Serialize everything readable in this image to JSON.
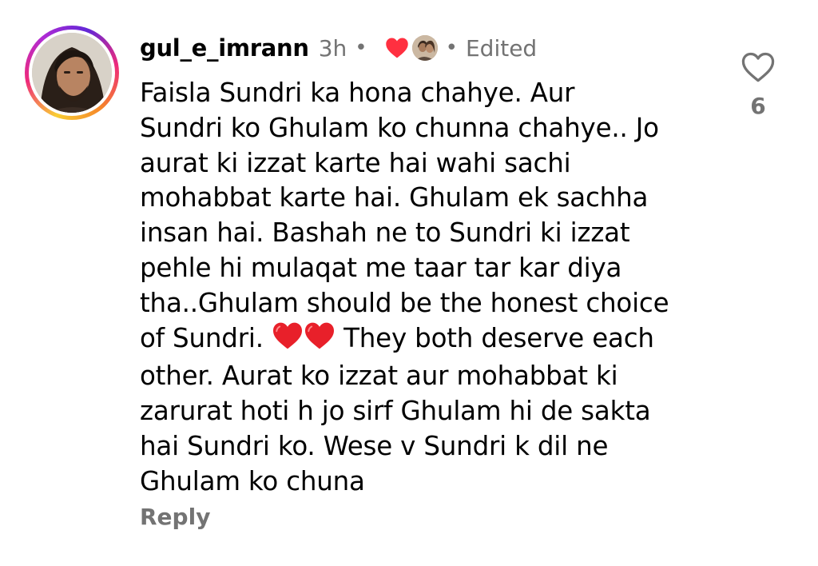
{
  "comment": {
    "username": "gul_e_imrann",
    "time": "3h",
    "separator": "•",
    "edited": "Edited",
    "lines": [
      "Faisla Sundri ka hona chahye. Aur",
      "Sundri ko Ghulam ko chunna chahye.. Jo",
      "aurat ki izzat karte hai wahi sachi",
      "mohabbat karte hai. Ghulam ek sachha",
      "insan hai. Bashah ne to Sundri ki izzat",
      "pehle hi mulaqat me taar tar kar diya",
      "tha..Ghulam should be the honest choice"
    ],
    "line8_before": "of Sundri.",
    "line8_after": "They both deserve each",
    "lines_after": [
      "other. Aurat ko izzat aur mohabbat ki",
      "zarurat hoti h jo sirf Ghulam hi de sakta",
      "hai Sundri ko. Wese v Sundri k dil ne",
      "Ghulam ko chuna"
    ],
    "reply_label": "Reply",
    "like_count": "6",
    "like_icon": "heart-outline-icon",
    "creator_heart_icon": "red-heart-icon",
    "inline_emoji": "red-heart-emoji"
  },
  "colors": {
    "secondary_text": "#737373",
    "heart_red": "#ff3040"
  }
}
